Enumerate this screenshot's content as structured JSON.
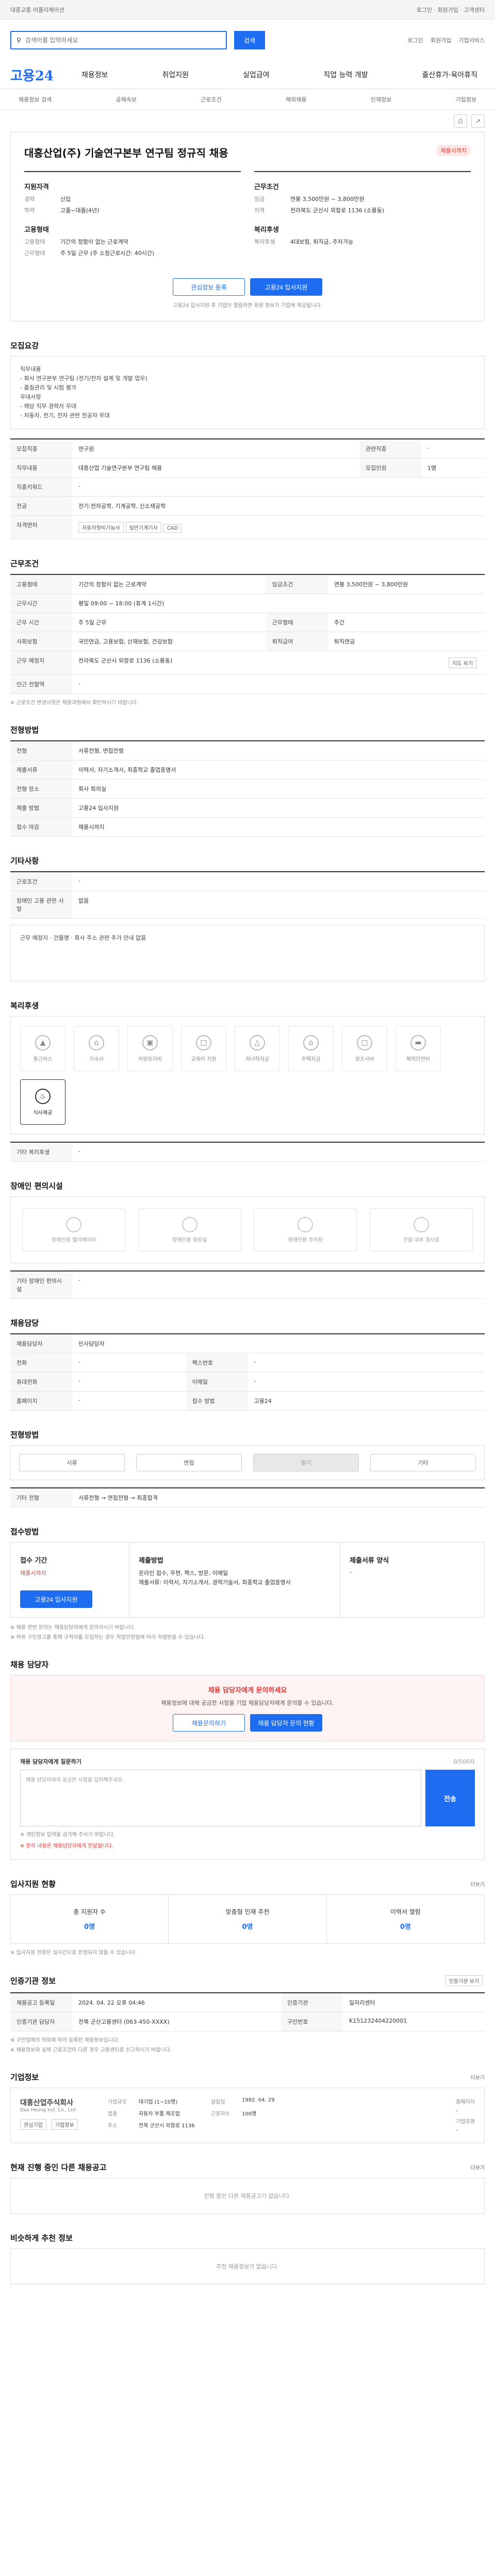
{
  "topbar": {
    "left": "대중교통 어플리케이션",
    "right": "로그인 · 회원가입 · 고객센터"
  },
  "search": {
    "placeholder": "검색어를 입력하세요",
    "button": "검색",
    "links": [
      "로그인",
      "회원가입",
      "기업서비스"
    ]
  },
  "gnb": {
    "logo": "고용24",
    "menu": [
      "채용정보",
      "취업지원",
      "실업급여",
      "직업 능력 개발",
      "출산휴가·육아휴직"
    ]
  },
  "lnb": [
    "채용정보 검색",
    "공채속보",
    "근로조건",
    "해외채용",
    "인재정보",
    "기업정보"
  ],
  "job": {
    "title": "대흥산업(주) 기술연구본부 연구팀 정규직 채용",
    "badge": "채용시까지",
    "left_title": "지원자격",
    "left_rows": [
      [
        "경력",
        "신입"
      ],
      [
        "학력",
        "고졸~대졸(4년)"
      ]
    ],
    "left2_title": "고용형태",
    "left2_rows": [
      [
        "고용형태",
        "기간의 정함이 없는 근로계약"
      ],
      [
        "근무형태",
        "주 5일 근무 (주 소정근로시간: 40시간)"
      ]
    ],
    "right_title": "근무조건",
    "right_rows": [
      [
        "임금",
        "연봉 3,500만원 ~ 3,800만원"
      ],
      [
        "지역",
        "전라북도 군산시 외항로 1136 (소룡동)"
      ]
    ],
    "right2_title": "복리후생",
    "right2_rows": [
      [
        "복리후생",
        "4대보험, 퇴직금, 주차가능"
      ]
    ],
    "btn_save": "관심정보 등록",
    "btn_apply": "고용24 입사지원",
    "note": "고용24 입사지원 후 기업이 열람하면 회원 정보가 기업에 제공됩니다."
  },
  "recruit": {
    "title": "모집요강",
    "body": [
      "직무내용",
      "- 회사 연구본부 연구팀 (전기/전자 설계 및 개발 업무)",
      "- 품질관리 및 시험 평가",
      "",
      "우대사항",
      "- 해당 직무 경력자 우대",
      "- 자동차, 전기, 전자 관련 전공자 우대"
    ],
    "rows": [
      [
        "모집직종",
        "연구원",
        "관련직종",
        "-"
      ],
      [
        "직무내용",
        "대흥산업 기술연구본부 연구팀 채용",
        "모집인원",
        "1명"
      ],
      [
        "직종키워드",
        "-",
        "",
        ""
      ]
    ],
    "major_th": "전공",
    "major": "전기·전자공학, 기계공학, 신소재공학",
    "cert_th": "자격면허",
    "certs": [
      "자동차정비기능사",
      "일반기계기사",
      "CAD"
    ]
  },
  "work": {
    "title": "근무조건",
    "rows": [
      [
        "고용형태",
        "기간의 정함이 없는 근로계약",
        "임금조건",
        "연봉 3,500만원 ~ 3,800만원"
      ],
      [
        "근무시간",
        "평일 09:00 ~ 18:00 (휴게 1시간)",
        "",
        ""
      ],
      [
        "근무 시간",
        "주 5일 근무",
        "근무형태",
        "주간"
      ],
      [
        "사회보험",
        "국민연금, 고용보험, 산재보험, 건강보험",
        "퇴직급여",
        "퇴직연금"
      ],
      [
        "근무 예정지",
        "전라북도 군산시 외항로 1136 (소룡동)",
        "",
        ""
      ],
      [
        "인근 전철역",
        "-",
        "",
        ""
      ]
    ],
    "map_btn": "지도 보기",
    "note": "※ 근로조건 변경사항은 채용과정에서 확인하시기 바랍니다."
  },
  "screen": {
    "title": "전형방법",
    "rows": [
      [
        "전형",
        "서류전형, 면접전형"
      ],
      [
        "제출서류",
        "이력서, 자기소개서, 최종학교 졸업증명서"
      ],
      [
        "전형 장소",
        "회사 회의실"
      ],
      [
        "제출 방법",
        "고용24 입사지원"
      ],
      [
        "접수 마감",
        "채용시까지"
      ]
    ]
  },
  "etc": {
    "title": "기타사항",
    "rows": [
      [
        "근로조건",
        "-"
      ],
      [
        "장애인 고용 관련 사항",
        "없음"
      ]
    ],
    "body": "근무 예정지 · 건물명 · 회사 주소 관련 추가 안내 없음"
  },
  "benefit": {
    "title": "복리후생",
    "items": [
      "통근버스",
      "기숙사",
      "차량유지비",
      "교육비 지원",
      "자녀학자금",
      "주택자금",
      "경조사비",
      "체력단련비",
      "식사제공"
    ],
    "active": 8,
    "etc_th": "기타 복리후생",
    "etc": "-"
  },
  "disab": {
    "title": "장애인 편의시설",
    "items": [
      "장애인용 엘리베이터",
      "장애인용 화장실",
      "장애인용 주차장",
      "건물 내부 경사로"
    ],
    "etc_th": "기타 장애인 편의시설",
    "etc": "-"
  },
  "contact": {
    "title": "채용담당",
    "rows": [
      [
        "채용담당자",
        "인사담당자",
        "",
        ""
      ],
      [
        "전화",
        "-",
        "팩스번호",
        "-"
      ],
      [
        "휴대전화",
        "-",
        "이메일",
        "-"
      ],
      [
        "홈페이지",
        "-",
        "접수 방법",
        "고용24"
      ]
    ]
  },
  "method": {
    "title": "전형방법",
    "items": [
      "서류",
      "면접",
      "필기",
      "기타"
    ],
    "active": 2,
    "etc_th": "기타 전형",
    "etc": "서류전형 → 면접전형 → 최종합격"
  },
  "apply": {
    "title": "접수방법",
    "label_left": "접수 기간",
    "period": "채용시까지",
    "apply_btn": "고용24 입사지원",
    "mid_title": "제출방법",
    "mid_body": [
      "온라인 접수, 우편, 팩스, 방문, 이메일",
      "제출서류: 이력서, 자기소개서, 경력기술서, 최종학교 졸업증명서"
    ],
    "right_title": "제출서류 양식",
    "right_body": "-"
  },
  "notice": [
    "※ 채용 관련 문의는 채용담당자에게 문의하시기 바랍니다.",
    "※ 허위 구인광고를 통해 구직자를 모집하는 경우 직업안정법에 따라 처벌받을 수 있습니다."
  ],
  "inquiry": {
    "title": "채용 담당자",
    "pink_title": "채용 담당자에게 문의하세요",
    "pink_body": "채용정보에 대해 궁금한 사항을 기업 채용담당자에게 문의할 수 있습니다.",
    "btn_a": "채용문의하기",
    "btn_b": "채용 담당자 문의 현황",
    "form_title": "채용 담당자에게 질문하기",
    "counter": "0/500자",
    "placeholder": "채용 담당자에게 궁금한 사항을 입력해주세요.",
    "send": "전송",
    "notes": [
      "※ 개인정보 입력을 삼가해 주시기 바랍니다.",
      "※ 문의 내용은 채용담당자에게 전달됩니다."
    ]
  },
  "stats": {
    "title": "입사지원 현황",
    "more": "더보기",
    "items": [
      [
        "총 지원자 수",
        "0명"
      ],
      [
        "맞춤형 인재 추천",
        "0명"
      ],
      [
        "이력서 열람",
        "0명"
      ]
    ],
    "note": "※ 입사지원 현황은 실시간으로 반영되지 않을 수 있습니다."
  },
  "org": {
    "title": "인증기관 정보",
    "btn": "인증기관 보기",
    "rows": [
      [
        "채용공고 등록일",
        "2024. 04. 22 오후 04:46",
        "인증기관",
        "일자리센터"
      ],
      [
        "인증기관 담당자",
        "전북 군산고용센터 (063-450-XXXX)",
        "구인번호",
        "K151232404220001"
      ]
    ],
    "notes": [
      "※ 구인업체의 의뢰에 따라 등록된 채용정보입니다.",
      "※ 채용정보와 실제 근로조건이 다른 경우 고용센터로 신고하시기 바랍니다."
    ]
  },
  "company": {
    "title": "기업정보",
    "more": "더보기",
    "name": "대흥산업주식회사",
    "name_en": "Dae Heung Ind. Co., Ltd.",
    "btn_a": "관심기업",
    "btn_b": "기업정보",
    "rows": [
      [
        "기업규모",
        "대기업 (1~10명)",
        "설립일",
        "1992. 04. 29",
        "홈페이지",
        "-"
      ],
      [
        "업종",
        "자동차 부품 제조업",
        "근로자수",
        "100명",
        "기업유형",
        "-"
      ],
      [
        "주소",
        "전북 군산시 외항로 1136",
        "",
        "",
        "",
        ""
      ]
    ]
  },
  "other": {
    "title": "현재 진행 중인 다른 채용공고",
    "note": "진행 중인 다른 채용공고가 없습니다.",
    "more": "더보기"
  },
  "recommend": {
    "title": "비슷하게 추천 정보",
    "body": "추천 채용정보가 없습니다."
  }
}
